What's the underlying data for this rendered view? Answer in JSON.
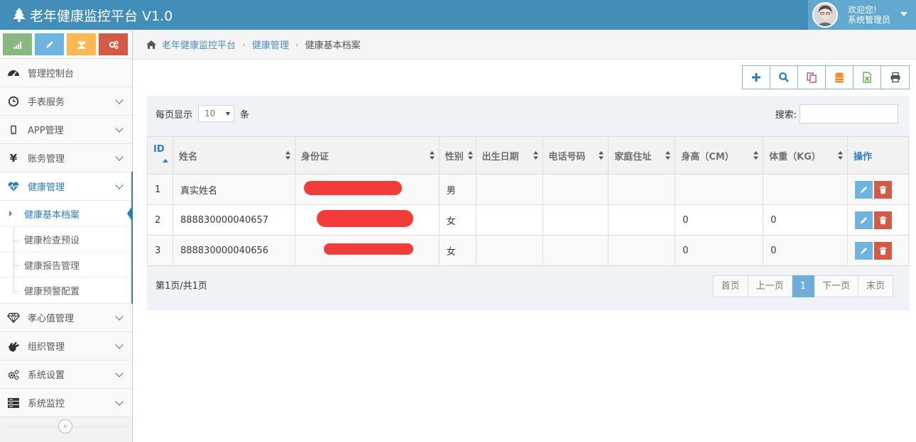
{
  "header": {
    "title": "老年健康监控平台 V1.0",
    "welcome": "欢迎您!",
    "user": "系统管理员"
  },
  "shortcuts": [
    {
      "icon": "signal-icon",
      "color": "#87b87f"
    },
    {
      "icon": "pencil-icon",
      "color": "#6fb3e0"
    },
    {
      "icon": "users-icon",
      "color": "#ffb752"
    },
    {
      "icon": "cogs-icon",
      "color": "#d15b47"
    }
  ],
  "sidebar": {
    "items": [
      {
        "label": "管理控制台"
      },
      {
        "label": "手表服务"
      },
      {
        "label": "APP管理"
      },
      {
        "label": "账务管理"
      },
      {
        "label": "健康管理"
      },
      {
        "label": "孝心值管理"
      },
      {
        "label": "组织管理"
      },
      {
        "label": "系统设置"
      },
      {
        "label": "系统监控"
      }
    ],
    "submenu": [
      {
        "label": "健康基本档案"
      },
      {
        "label": "健康检查预设"
      },
      {
        "label": "健康报告管理"
      },
      {
        "label": "健康预警配置"
      }
    ],
    "collapse_label": "«"
  },
  "breadcrumb": {
    "home": "老年健康监控平台",
    "section": "健康管理",
    "current": "健康基本档案"
  },
  "toolbar": {
    "buttons": [
      {
        "icon": "plus-icon",
        "color": "#2b7dbc"
      },
      {
        "icon": "search-icon",
        "color": "#2b7dbc"
      },
      {
        "icon": "copy-icon",
        "color": "#c161a5"
      },
      {
        "icon": "database-icon",
        "color": "#ff892a"
      },
      {
        "icon": "excel-icon",
        "color": "#69aa46"
      },
      {
        "icon": "print-icon",
        "color": "#555555"
      }
    ]
  },
  "table": {
    "length_label": "每页显示",
    "length_value": "10",
    "length_unit": "条",
    "search_label": "搜索:",
    "columns": [
      "ID",
      "姓名",
      "身份证",
      "性别",
      "出生日期",
      "电话号码",
      "家庭住址",
      "身高（CM）",
      "体重（KG）",
      "操作"
    ],
    "rows": [
      {
        "id": "1",
        "name": "真实姓名",
        "gender": "男",
        "birth": "",
        "phone": "",
        "address": "",
        "height": "",
        "weight": ""
      },
      {
        "id": "2",
        "name": "888830000040657",
        "gender": "女",
        "birth": "",
        "phone": "",
        "address": "",
        "height": "0",
        "weight": "0"
      },
      {
        "id": "3",
        "name": "888830000040656",
        "gender": "女",
        "birth": "",
        "phone": "",
        "address": "",
        "height": "0",
        "weight": "0"
      }
    ],
    "page_info": "第1页/共1页",
    "pager": [
      "首页",
      "上一页",
      "1",
      "下一页",
      "末页"
    ]
  },
  "colors": {
    "header": "#438eb9",
    "accent": "#2b7dbc",
    "redaction": "#f23b3b"
  }
}
